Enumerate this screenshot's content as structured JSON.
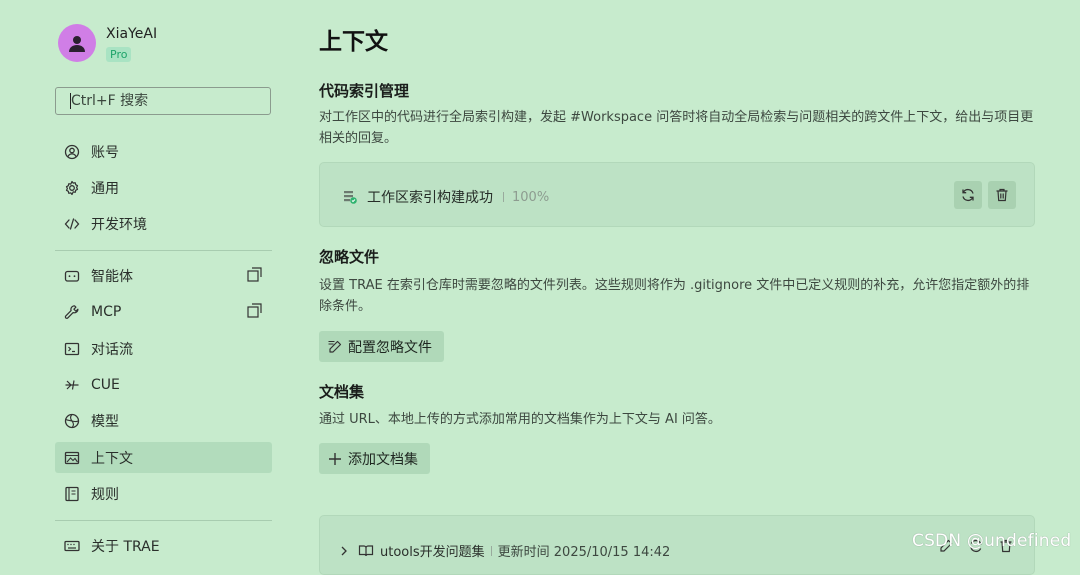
{
  "user": {
    "name": "XiaYeAI",
    "badge": "Pro"
  },
  "search": {
    "placeholder": "Ctrl+F 搜索"
  },
  "sidebar": {
    "items": [
      {
        "label": "账号"
      },
      {
        "label": "通用"
      },
      {
        "label": "开发环境"
      },
      {
        "label": "智能体"
      },
      {
        "label": "MCP"
      },
      {
        "label": "对话流"
      },
      {
        "label": "CUE"
      },
      {
        "label": "模型"
      },
      {
        "label": "上下文"
      },
      {
        "label": "规则"
      },
      {
        "label": "关于 TRAE"
      }
    ],
    "active_item": "上下文"
  },
  "page": {
    "title": "上下文"
  },
  "code_index": {
    "title": "代码索引管理",
    "description": "对工作区中的代码进行全局索引构建，发起 #Workspace 问答时将自动全局检索与问题相关的跨文件上下文，给出与项目更相关的回复。",
    "status": "工作区索引构建成功",
    "progress": "100%"
  },
  "ignore_files": {
    "title": "忽略文件",
    "description": "设置 TRAE 在索引仓库时需要忽略的文件列表。这些规则将作为 .gitignore 文件中已定义规则的补充，允许您指定额外的排除条件。",
    "button": "配置忽略文件"
  },
  "docs": {
    "title": "文档集",
    "description": "通过 URL、本地上传的方式添加常用的文档集作为上下文与 AI 问答。",
    "button": "添加文档集",
    "items": [
      {
        "name": "utools开发问题集",
        "updated": "更新时间 2025/10/15 14:42"
      }
    ]
  },
  "watermark": "CSDN @undefined",
  "colors": {
    "background": "#c7ebcd",
    "accent_pro": "#1ea36a",
    "avatar": "#d07ee6",
    "success": "#2fb36f"
  }
}
